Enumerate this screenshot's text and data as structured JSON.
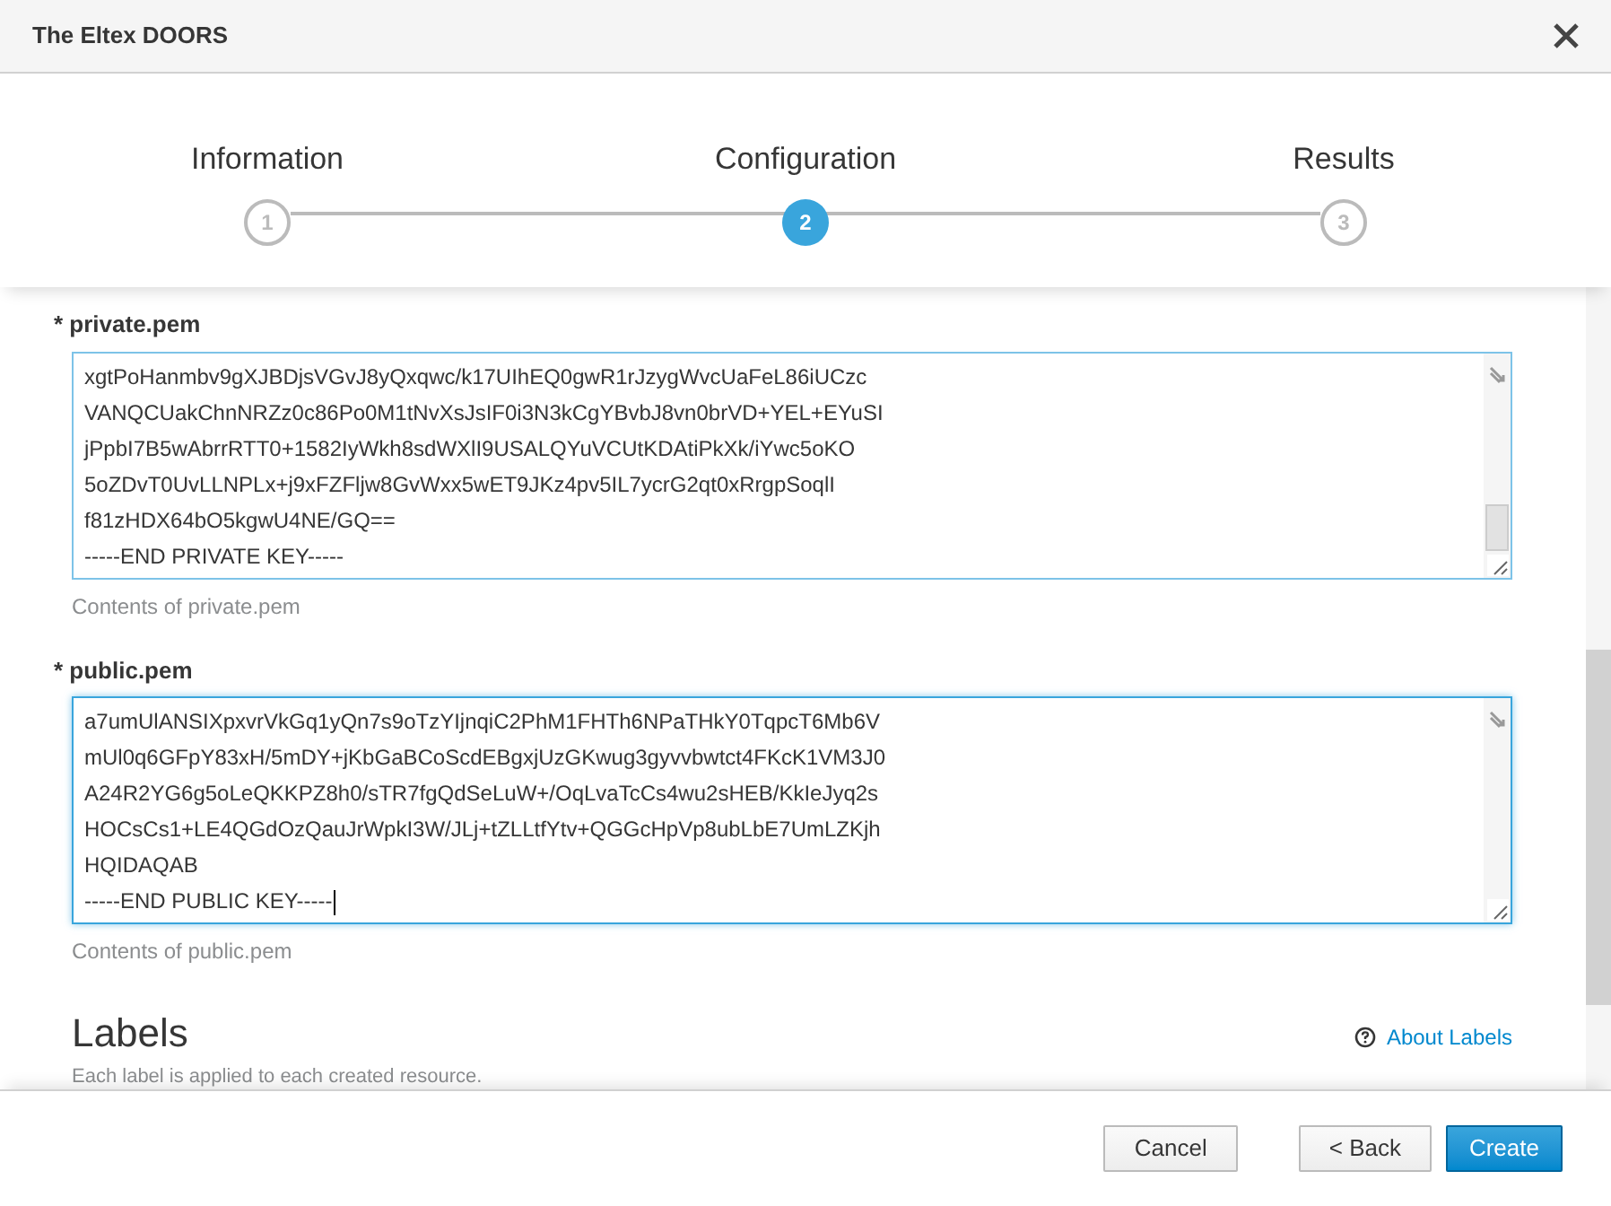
{
  "window": {
    "title": "The Eltex DOORS"
  },
  "steps": [
    {
      "label": "Information",
      "number": "1",
      "selected": false
    },
    {
      "label": "Configuration",
      "number": "2",
      "selected": true
    },
    {
      "label": "Results",
      "number": "3",
      "selected": false
    }
  ],
  "fields": [
    {
      "label": "* private.pem",
      "focused": false,
      "lines": [
        "xgtPoHanmbv9gXJBDjsVGvJ8yQxqwc/k17UIhEQ0gwR1rJzygWvcUaFeL86iUCzc",
        "VANQCUakChnNRZz0c86Po0M1tNvXsJsIF0i3N3kCgYBvbJ8vn0brVD+YEL+EYuSI",
        "jPpbI7B5wAbrrRTT0+1582IyWkh8sdWXlI9USALQYuVCUtKDAtiPkXk/iYwc5oKO",
        "5oZDvT0UvLLNPLx+j9xFZFljw8GvWxx5wET9JKz4pv5IL7ycrG2qt0xRrgpSoqlI",
        "f81zHDX64bO5kgwU4NE/GQ==",
        "-----END PRIVATE KEY-----"
      ],
      "help": "Contents of private.pem"
    },
    {
      "label": "* public.pem",
      "focused": true,
      "lines": [
        "a7umUlANSIXpxvrVkGq1yQn7s9oTzYIjnqiC2PhM1FHTh6NPaTHkY0TqpcT6Mb6V",
        "mUl0q6GFpY83xH/5mDY+jKbGaBCoScdEBgxjUzGKwug3gyvvbwtct4FKcK1VM3J0",
        "A24R2YG6g5oLeQKKPZ8h0/sTR7fgQdSeLuW+/OqLvaTcCs4wu2sHEB/KkIeJyq2s",
        "HOCsCs1+LE4QGdOzQauJrWpkI3W/JLj+tZLLtfYtv+QGGcHpVp8ubLbE7UmLZKjh",
        "HQIDAQAB",
        "-----END PUBLIC KEY-----"
      ],
      "help": "Contents of public.pem"
    }
  ],
  "labels_section": {
    "title": "Labels",
    "link": "About Labels",
    "description": "Each label is applied to each created resource."
  },
  "buttons": [
    {
      "label": "Cancel",
      "kind": "default"
    },
    {
      "label": "< Back",
      "kind": "default"
    },
    {
      "label": "Create",
      "kind": "primary"
    }
  ]
}
